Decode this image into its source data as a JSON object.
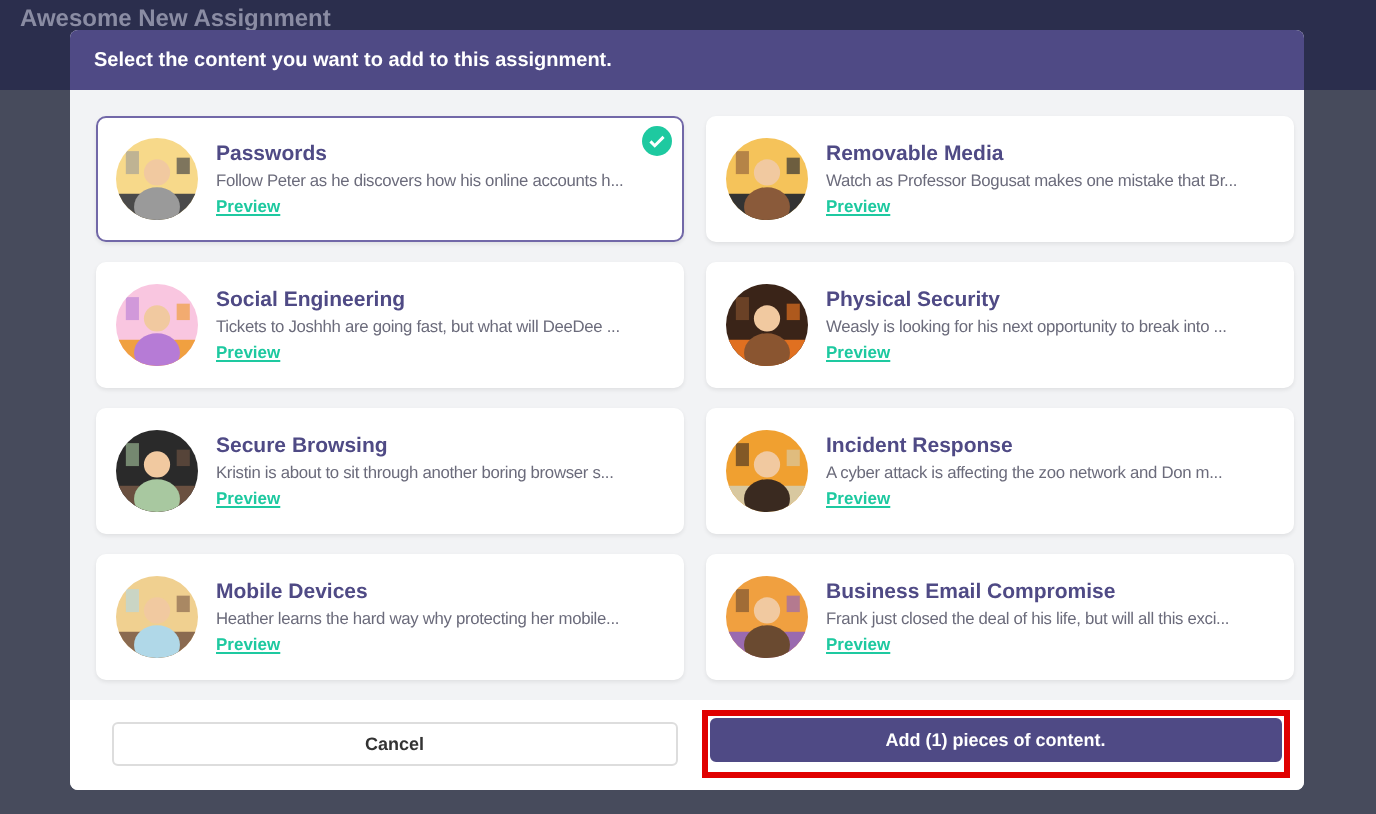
{
  "page": {
    "title": "Awesome New Assignment"
  },
  "modal": {
    "header": "Select the content you want to add to this assignment.",
    "items": [
      {
        "title": "Passwords",
        "description": "Follow Peter as he discovers how his online accounts h...",
        "link": "Preview",
        "selected": true
      },
      {
        "title": "Removable Media",
        "description": "Watch as Professor Bogusat makes one mistake that Br...",
        "link": "Preview",
        "selected": false
      },
      {
        "title": "Social Engineering",
        "description": "Tickets to Joshhh are going fast, but what will DeeDee ...",
        "link": "Preview",
        "selected": false
      },
      {
        "title": "Physical Security",
        "description": "Weasly is looking for his next opportunity to break into ...",
        "link": "Preview",
        "selected": false
      },
      {
        "title": "Secure Browsing",
        "description": "Kristin is about to sit through another boring browser s...",
        "link": "Preview",
        "selected": false
      },
      {
        "title": "Incident Response",
        "description": "A cyber attack is affecting the zoo network and Don m...",
        "link": "Preview",
        "selected": false
      },
      {
        "title": "Mobile Devices",
        "description": "Heather learns the hard way why protecting her mobile...",
        "link": "Preview",
        "selected": false
      },
      {
        "title": "Business Email Compromise",
        "description": "Frank just closed the deal of his life, but will all this exci...",
        "link": "Preview",
        "selected": false
      }
    ],
    "buttons": [
      {
        "label": "Cancel",
        "kind": "secondary",
        "highlighted": false
      },
      {
        "label": "Add (1) pieces of content.",
        "kind": "primary",
        "highlighted": true
      }
    ]
  }
}
